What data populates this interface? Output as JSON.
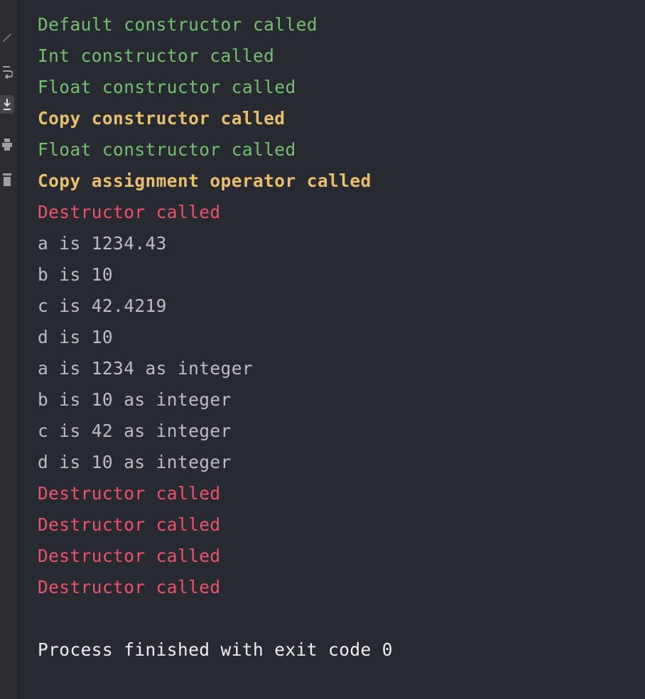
{
  "console": {
    "truncated_top_line": "",
    "lines": [
      {
        "text": "Default constructor called",
        "kind": "green"
      },
      {
        "text": "Int constructor called",
        "kind": "green"
      },
      {
        "text": "Float constructor called",
        "kind": "green"
      },
      {
        "text": "Copy constructor called",
        "kind": "yellow"
      },
      {
        "text": "Float constructor called",
        "kind": "green"
      },
      {
        "text": "Copy assignment operator called",
        "kind": "yellow"
      },
      {
        "text": "Destructor called",
        "kind": "red"
      },
      {
        "text": "a is 1234.43",
        "kind": "gray"
      },
      {
        "text": "b is 10",
        "kind": "gray"
      },
      {
        "text": "c is 42.4219",
        "kind": "gray"
      },
      {
        "text": "d is 10",
        "kind": "gray"
      },
      {
        "text": "a is 1234 as integer",
        "kind": "gray"
      },
      {
        "text": "b is 10 as integer",
        "kind": "gray"
      },
      {
        "text": "c is 42 as integer",
        "kind": "gray"
      },
      {
        "text": "d is 10 as integer",
        "kind": "gray"
      },
      {
        "text": "Destructor called",
        "kind": "red"
      },
      {
        "text": "Destructor called",
        "kind": "red"
      },
      {
        "text": "Destructor called",
        "kind": "red"
      },
      {
        "text": "Destructor called",
        "kind": "red"
      },
      {
        "text": "",
        "kind": "gray"
      },
      {
        "text": "Process finished with exit code 0",
        "kind": "white"
      }
    ]
  },
  "gutter": {
    "icons": [
      "edit-icon",
      "soft-wrap-icon",
      "scroll-to-end-icon",
      "print-icon",
      "trash-icon"
    ]
  },
  "colors": {
    "background": "#282a31",
    "green": "#73c06f",
    "yellow": "#e8bf6a",
    "red": "#f0526c",
    "gray": "#bcbec4",
    "white": "#eef0f3"
  }
}
